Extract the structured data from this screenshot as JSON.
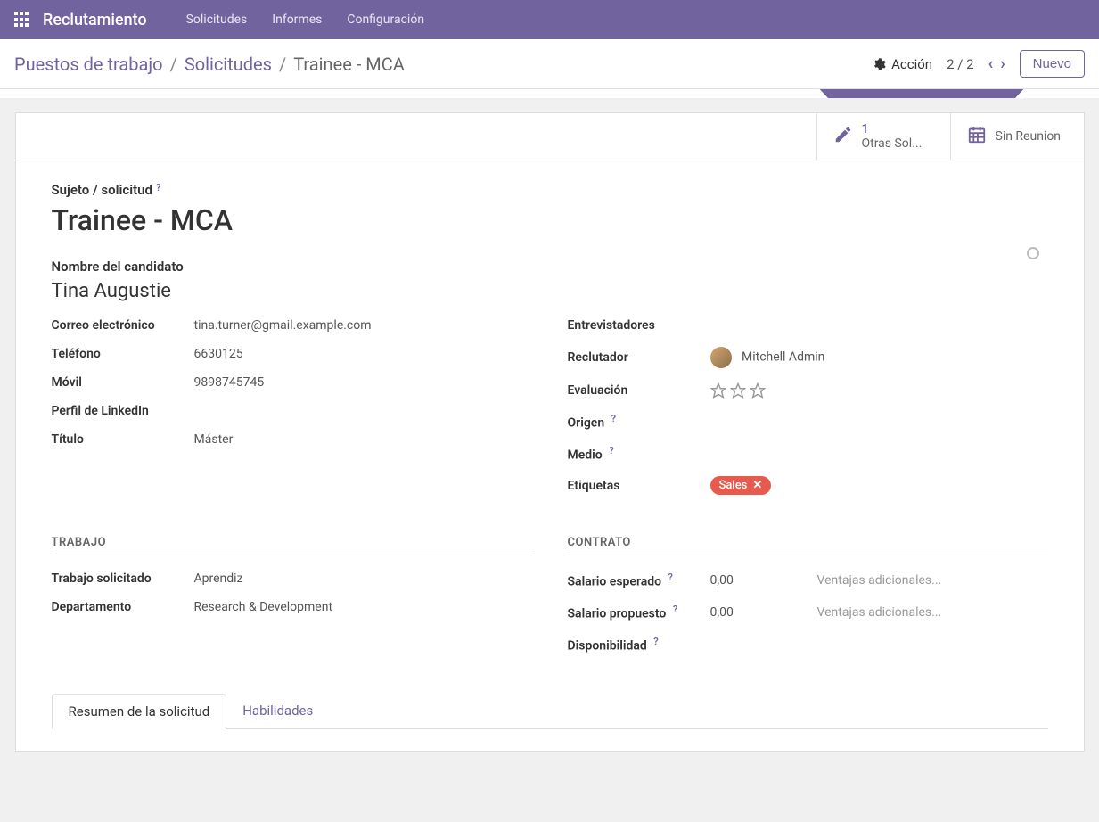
{
  "nav": {
    "brand": "Reclutamiento",
    "items": [
      "Solicitudes",
      "Informes",
      "Configuración"
    ]
  },
  "breadcrumb": {
    "items": [
      "Puestos de trabajo",
      "Solicitudes"
    ],
    "current": "Trainee - MCA"
  },
  "header": {
    "action_label": "Acción",
    "pager": "2 / 2",
    "new_button": "Nuevo"
  },
  "stat_buttons": {
    "other_apps": {
      "count": "1",
      "label": "Otras Sol..."
    },
    "meetings": {
      "label": "Sin Reunion"
    }
  },
  "form": {
    "subject_label": "Sujeto / solicitud",
    "subject_value": "Trainee - MCA",
    "candidate_label": "Nombre del candidato",
    "candidate_value": "Tina Augustie",
    "email_label": "Correo electrónico",
    "email_value": "tina.turner@gmail.example.com",
    "phone_label": "Teléfono",
    "phone_value": "6630125",
    "mobile_label": "Móvil",
    "mobile_value": "9898745745",
    "linkedin_label": "Perfil de LinkedIn",
    "linkedin_value": "",
    "degree_label": "Título",
    "degree_value": "Máster",
    "interviewers_label": "Entrevistadores",
    "recruiter_label": "Reclutador",
    "recruiter_value": "Mitchell Admin",
    "evaluation_label": "Evaluación",
    "source_label": "Origen",
    "medium_label": "Medio",
    "tags_label": "Etiquetas",
    "tag_value": "Sales"
  },
  "job_section": {
    "title": "TRABAJO",
    "applied_label": "Trabajo solicitado",
    "applied_value": "Aprendiz",
    "department_label": "Departamento",
    "department_value": "Research & Development"
  },
  "contract_section": {
    "title": "CONTRATO",
    "expected_label": "Salario esperado",
    "expected_value": "0,00",
    "expected_extra": "Ventajas adicionales...",
    "proposed_label": "Salario propuesto",
    "proposed_value": "0,00",
    "proposed_extra": "Ventajas adicionales...",
    "availability_label": "Disponibilidad"
  },
  "tabs": {
    "summary": "Resumen de la solicitud",
    "skills": "Habilidades"
  }
}
